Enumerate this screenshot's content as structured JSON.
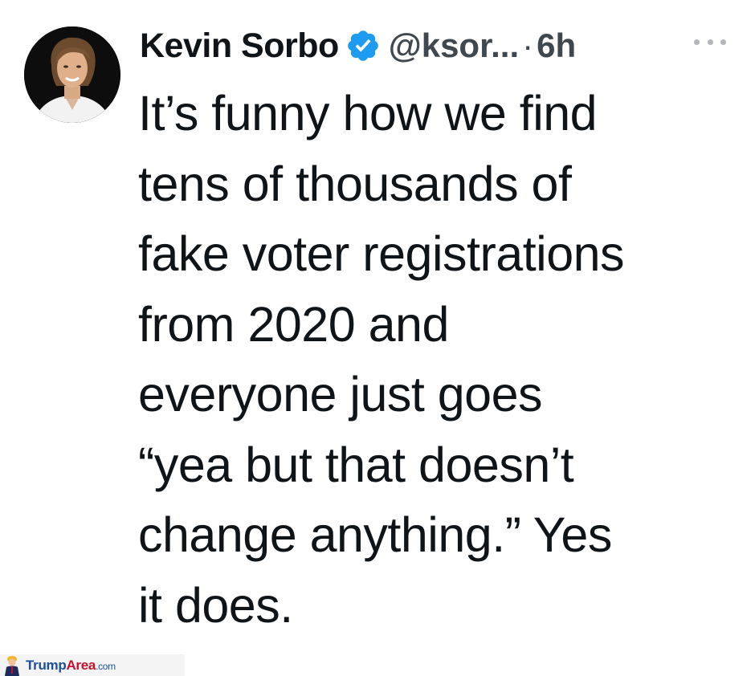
{
  "tweet": {
    "display_name": "Kevin Sorbo",
    "handle": "@ksor...",
    "separator": "·",
    "time": "6h",
    "verified": true,
    "text": "It’s funny how we find\ntens of thousands of\nfake voter registrations\nfrom 2020 and\neveryone just goes\n“yea but that doesn’t\nchange anything.” Yes\nit does.",
    "icons": {
      "verified": "verified-badge-icon",
      "more": "more-horizontal-icon"
    },
    "colors": {
      "verified_blue": "#1d9bf0",
      "text": "#0f1419",
      "secondary": "#536471"
    }
  },
  "watermark": {
    "brand_part1": "Trump",
    "brand_part2": "Area",
    "brand_tld": ".com"
  }
}
